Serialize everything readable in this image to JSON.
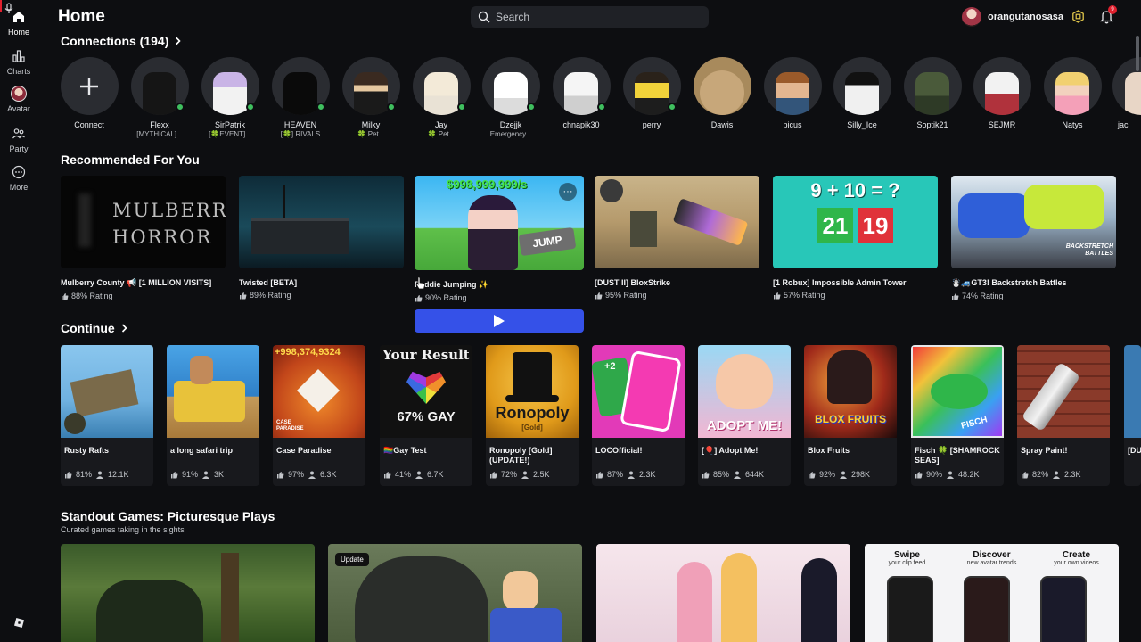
{
  "nav": {
    "items": [
      {
        "label": "Home",
        "icon": "home-icon"
      },
      {
        "label": "Charts",
        "icon": "charts-icon"
      },
      {
        "label": "Avatar",
        "icon": "avatar-icon"
      },
      {
        "label": "Party",
        "icon": "party-icon"
      },
      {
        "label": "More",
        "icon": "more-icon"
      }
    ]
  },
  "header": {
    "title": "Home",
    "search_placeholder": "Search",
    "username": "orangutanosasa",
    "notification_count": "9"
  },
  "connections": {
    "title": "Connections (194)",
    "connect_label": "Connect",
    "friends": [
      {
        "name": "Flexx",
        "status": "[MYTHICAL]...",
        "online": true
      },
      {
        "name": "SirPatrik",
        "status": "[🍀EVENT]...",
        "online": true
      },
      {
        "name": "HEAVEN",
        "status": "[🍀] RIVALS",
        "online": true
      },
      {
        "name": "Milky",
        "status": "🍀 Pet...",
        "online": true
      },
      {
        "name": "Jay",
        "status": "🍀 Pet...",
        "online": true
      },
      {
        "name": "Dzejjk",
        "status": "Emergency...",
        "online": true
      },
      {
        "name": "chnapik30",
        "status": "",
        "online": true
      },
      {
        "name": "perry",
        "status": "",
        "online": true
      },
      {
        "name": "Dawis",
        "status": "",
        "online": false
      },
      {
        "name": "picus",
        "status": "",
        "online": false
      },
      {
        "name": "Silly_Ice",
        "status": "",
        "online": false
      },
      {
        "name": "Soptik21",
        "status": "",
        "online": false
      },
      {
        "name": "SEJMR",
        "status": "",
        "online": false
      },
      {
        "name": "Natys",
        "status": "",
        "online": false
      },
      {
        "name": "jac",
        "status": "",
        "online": false
      }
    ]
  },
  "recommended": {
    "title": "Recommended For You",
    "games": [
      {
        "title": "Mulberry County 📢 [1 MILLION VISITS]",
        "rating": "88% Rating",
        "thumb_text": "MULBERRY HORROR"
      },
      {
        "title": "Twisted [BETA]",
        "rating": "89% Rating",
        "thumb_text": ""
      },
      {
        "title": "Paddie Jumping ✨",
        "rating": "90% Rating",
        "thumb_text": "$998,999,999/s",
        "thumb_text2": "JUMP"
      },
      {
        "title": "[DUST II] BloxStrike",
        "rating": "95% Rating",
        "thumb_text": ""
      },
      {
        "title": "[1 Robux] Impossible Admin Tower",
        "rating": "57% Rating",
        "thumb_text": "9 + 10 = ?",
        "thumb_text2": "21",
        "thumb_text3": "19"
      },
      {
        "title": "☃️🚙GT3! Backstretch Battles",
        "rating": "74% Rating",
        "thumb_text": "BACKSTRETCH BATTLES"
      }
    ]
  },
  "continue": {
    "title": "Continue",
    "games": [
      {
        "title": "Rusty Rafts",
        "rating": "81%",
        "players": "12.1K",
        "thumb_text": ""
      },
      {
        "title": "a long safari trip",
        "rating": "91%",
        "players": "3K",
        "thumb_text": ""
      },
      {
        "title": "Case Paradise",
        "rating": "97%",
        "players": "6.3K",
        "thumb_text": "+998,374,9324",
        "thumb_text2": "CASE PARADISE"
      },
      {
        "title": "🏳️‍🌈Gay Test",
        "rating": "41%",
        "players": "6.7K",
        "thumb_text": "Your Result",
        "thumb_text2": "67% GAY"
      },
      {
        "title": "Ronopoly [Gold] (UPDATE!)",
        "rating": "72%",
        "players": "2.5K",
        "thumb_text": "Ronopoly",
        "thumb_text2": "[Gold]"
      },
      {
        "title": "LOCOfficial!",
        "rating": "87%",
        "players": "2.3K",
        "thumb_text": "+2"
      },
      {
        "title": "[🎈] Adopt Me!",
        "rating": "85%",
        "players": "644K",
        "thumb_text": "ADOPT ME!"
      },
      {
        "title": "Blox Fruits",
        "rating": "92%",
        "players": "298K",
        "thumb_text": "BLOX FRUITS"
      },
      {
        "title": "Fisch 🍀 [SHAMROCK SEAS]",
        "rating": "90%",
        "players": "48.2K",
        "thumb_text": "FISCH"
      },
      {
        "title": "Spray Paint!",
        "rating": "82%",
        "players": "2.3K",
        "thumb_text": ""
      },
      {
        "title": "[DU",
        "rating": "",
        "players": "",
        "thumb_text": ""
      }
    ]
  },
  "standout": {
    "title": "Standout Games: Picturesque Plays",
    "subtitle": "Curated games taking in the sights",
    "update_label": "Update",
    "card4": [
      {
        "head": "Swipe",
        "sub": "your clip feed"
      },
      {
        "head": "Discover",
        "sub": "new avatar trends"
      },
      {
        "head": "Create",
        "sub": "your own videos"
      }
    ]
  },
  "colors": {
    "background": "#0d0e11",
    "play_button": "#3551e8",
    "online": "#3fbf5f",
    "badge": "#e0202e"
  }
}
